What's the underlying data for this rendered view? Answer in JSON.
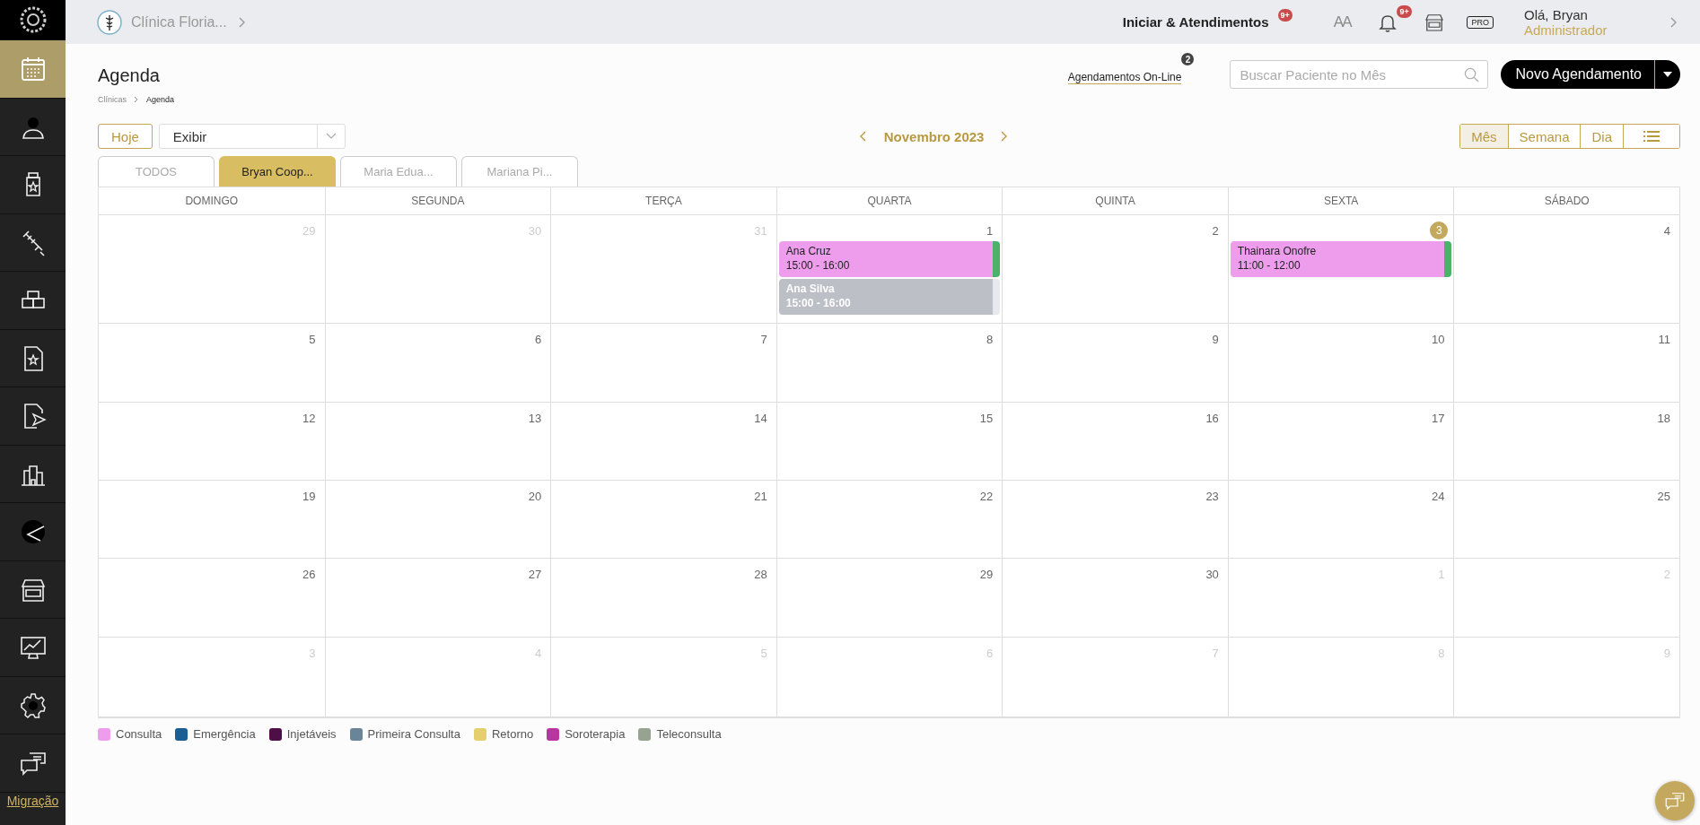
{
  "sidebar": {
    "items": [
      {
        "kind": "logo",
        "selected": false
      },
      {
        "kind": "calendar",
        "selected": true
      },
      {
        "kind": "user",
        "selected": false
      },
      {
        "kind": "bottle",
        "selected": false
      },
      {
        "kind": "syringe",
        "selected": false
      },
      {
        "kind": "boxes",
        "selected": false
      },
      {
        "kind": "doc-star",
        "selected": false
      },
      {
        "kind": "doc-send",
        "selected": false
      },
      {
        "kind": "buildings",
        "selected": false
      },
      {
        "kind": "pie",
        "selected": false
      },
      {
        "kind": "store",
        "selected": false
      },
      {
        "kind": "monitor-chart",
        "selected": false
      },
      {
        "kind": "gear",
        "selected": false
      },
      {
        "kind": "chat",
        "selected": false
      }
    ],
    "footer_link": "Migração"
  },
  "topbar": {
    "clinic": "Clínica Floria...",
    "start_link": "Iniciar & Atendimentos",
    "start_badge": "9+",
    "font_size_glyph": "AA",
    "notifications_badge": "9+",
    "pro_badge": "PRO",
    "greeting": "Olá, Bryan",
    "role": "Administrador"
  },
  "page": {
    "title": "Agenda",
    "breadcrumb": [
      "Clínicas",
      "Agenda"
    ],
    "online_link": "Agendamentos On-Line",
    "online_badge": "2",
    "search": {
      "placeholder": "Buscar Paciente no Mês"
    },
    "new_button": "Novo Agendamento"
  },
  "toolbar": {
    "today_button": "Hoje",
    "display_select": "Exibir",
    "month": "Novembro 2023",
    "views": [
      {
        "kind": "text",
        "label": "Mês",
        "selected": true
      },
      {
        "kind": "text",
        "label": "Semana",
        "selected": false
      },
      {
        "kind": "text",
        "label": "Dia",
        "selected": false
      },
      {
        "kind": "list",
        "selected": false
      }
    ]
  },
  "professional_tabs": [
    {
      "label": "TODOS",
      "selected": false
    },
    {
      "label": "Bryan Coop...",
      "selected": true
    },
    {
      "label": "Maria Edua...",
      "selected": false
    },
    {
      "label": "Mariana Pi...",
      "selected": false
    }
  ],
  "calendar": {
    "weekdays": [
      "DOMINGO",
      "SEGUNDA",
      "TERÇA",
      "QUARTA",
      "QUINTA",
      "SEXTA",
      "SÁBADO"
    ],
    "weeks": [
      [
        {
          "day": "29",
          "other_month": true,
          "today": false
        },
        {
          "day": "30",
          "other_month": true,
          "today": false
        },
        {
          "day": "31",
          "other_month": true,
          "today": false
        },
        {
          "day": "1",
          "other_month": false,
          "today": false,
          "events": [
            {
              "name": "Ana Cruz",
              "time": "15:00 - 16:00",
              "color": "#ee9ded",
              "confirmed": true,
              "bold": false
            },
            {
              "name": "Ana Silva",
              "time": "15:00 - 16:00",
              "color": "#bcbfc6",
              "confirmed": false,
              "bold": true
            }
          ]
        },
        {
          "day": "2",
          "other_month": false,
          "today": false
        },
        {
          "day": "3",
          "other_month": false,
          "today": true,
          "events": [
            {
              "name": "Thainara Onofre",
              "time": "11:00 - 12:00",
              "color": "#ee9ded",
              "confirmed": true,
              "bold": false
            }
          ]
        },
        {
          "day": "4",
          "other_month": false,
          "today": false
        }
      ],
      [
        {
          "day": "5",
          "other_month": false,
          "today": false
        },
        {
          "day": "6",
          "other_month": false,
          "today": false
        },
        {
          "day": "7",
          "other_month": false,
          "today": false
        },
        {
          "day": "8",
          "other_month": false,
          "today": false
        },
        {
          "day": "9",
          "other_month": false,
          "today": false
        },
        {
          "day": "10",
          "other_month": false,
          "today": false
        },
        {
          "day": "11",
          "other_month": false,
          "today": false
        }
      ],
      [
        {
          "day": "12",
          "other_month": false,
          "today": false
        },
        {
          "day": "13",
          "other_month": false,
          "today": false
        },
        {
          "day": "14",
          "other_month": false,
          "today": false
        },
        {
          "day": "15",
          "other_month": false,
          "today": false
        },
        {
          "day": "16",
          "other_month": false,
          "today": false
        },
        {
          "day": "17",
          "other_month": false,
          "today": false
        },
        {
          "day": "18",
          "other_month": false,
          "today": false
        }
      ],
      [
        {
          "day": "19",
          "other_month": false,
          "today": false
        },
        {
          "day": "20",
          "other_month": false,
          "today": false
        },
        {
          "day": "21",
          "other_month": false,
          "today": false
        },
        {
          "day": "22",
          "other_month": false,
          "today": false
        },
        {
          "day": "23",
          "other_month": false,
          "today": false
        },
        {
          "day": "24",
          "other_month": false,
          "today": false
        },
        {
          "day": "25",
          "other_month": false,
          "today": false
        }
      ],
      [
        {
          "day": "26",
          "other_month": false,
          "today": false
        },
        {
          "day": "27",
          "other_month": false,
          "today": false
        },
        {
          "day": "28",
          "other_month": false,
          "today": false
        },
        {
          "day": "29",
          "other_month": false,
          "today": false
        },
        {
          "day": "30",
          "other_month": false,
          "today": false
        },
        {
          "day": "1",
          "other_month": true,
          "today": false
        },
        {
          "day": "2",
          "other_month": true,
          "today": false
        }
      ],
      [
        {
          "day": "3",
          "other_month": true,
          "today": false
        },
        {
          "day": "4",
          "other_month": true,
          "today": false
        },
        {
          "day": "5",
          "other_month": true,
          "today": false
        },
        {
          "day": "6",
          "other_month": true,
          "today": false
        },
        {
          "day": "7",
          "other_month": true,
          "today": false
        },
        {
          "day": "8",
          "other_month": true,
          "today": false
        },
        {
          "day": "9",
          "other_month": true,
          "today": false
        }
      ]
    ]
  },
  "legend": [
    {
      "label": "Consulta",
      "color": "#ee9ded"
    },
    {
      "label": "Emergência",
      "color": "#1b5e94"
    },
    {
      "label": "Injetáveis",
      "color": "#4e0f48"
    },
    {
      "label": "Primeira Consulta",
      "color": "#6a8498"
    },
    {
      "label": "Retorno",
      "color": "#e5cf6c"
    },
    {
      "label": "Soroterapia",
      "color": "#b7369f"
    },
    {
      "label": "Teleconsulta",
      "color": "#97a391"
    }
  ]
}
